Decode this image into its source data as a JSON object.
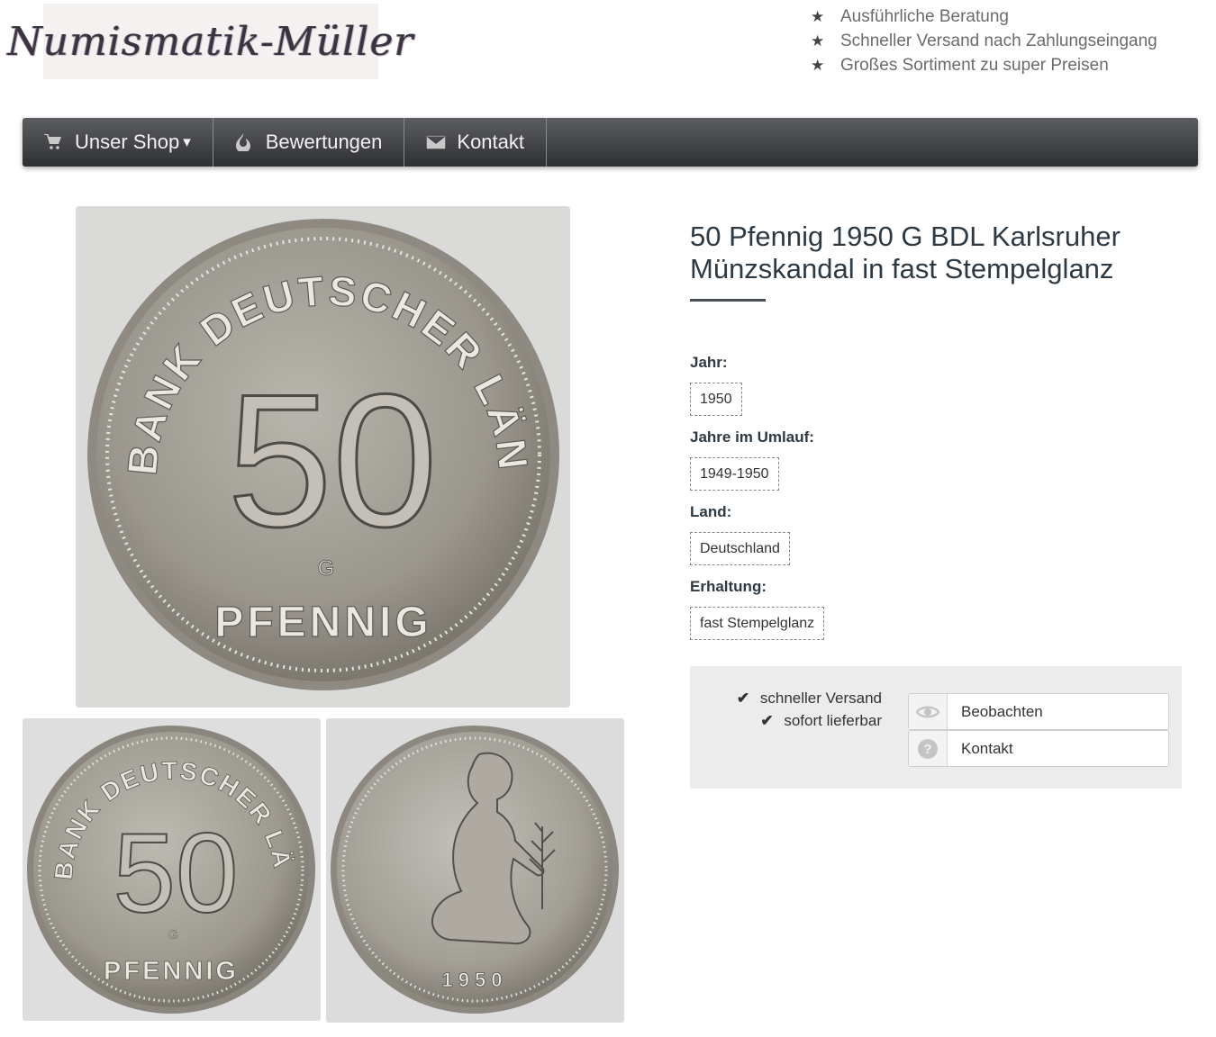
{
  "header": {
    "logo_text": "Numismatik-Müller",
    "usp": [
      "Ausführliche Beratung",
      "Schneller Versand nach Zahlungseingang",
      "Großes Sortiment zu super Preisen"
    ]
  },
  "nav": {
    "items": [
      {
        "label": "Unser Shop",
        "caret": "▾",
        "icon": "cart-icon"
      },
      {
        "label": "Bewertungen",
        "icon": "flame-icon"
      },
      {
        "label": "Kontakt",
        "icon": "envelope-icon"
      }
    ]
  },
  "product": {
    "title": "50 Pfennig 1950 G BDL Karlsruher Münzskandal in fast Stempelglanz",
    "attributes": [
      {
        "label": "Jahr:",
        "value": "1950"
      },
      {
        "label": "Jahre im Umlauf:",
        "value": "1949-1950"
      },
      {
        "label": "Land:",
        "value": "Deutschland"
      },
      {
        "label": "Erhaltung:",
        "value": "fast Stempelglanz"
      }
    ],
    "images": {
      "obverse_text_top": "BANK DEUTSCHER LÄNDER",
      "obverse_value": "50",
      "obverse_bottom": "PFENNIG",
      "mint_mark": "G",
      "reverse_year": "1950"
    }
  },
  "actions": {
    "features": [
      "schneller Versand",
      "sofort lieferbar"
    ],
    "watch_label": "Beobachten",
    "contact_label": "Kontakt"
  },
  "colors": {
    "nav_top": "#5b5d61",
    "nav_bottom": "#2f3033",
    "title": "#2d3a44",
    "panel_bg": "#ececec"
  }
}
